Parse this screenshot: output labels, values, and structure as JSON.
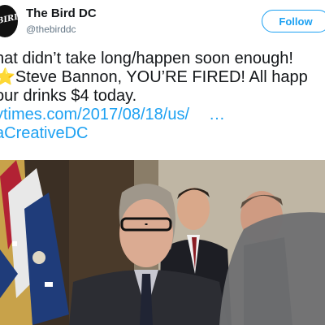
{
  "account": {
    "display_name": "The Bird DC",
    "handle": "@thebirddc",
    "avatar_text": "BIRD"
  },
  "follow_button": {
    "label": "Follow"
  },
  "tweet": {
    "line1": "hat didn’t take long/happen soon enough!",
    "line2_star": "⭐",
    "line2_text": "Steve Bannon, YOU’RE FIRED! All happ",
    "line3": "our drinks $4 today.",
    "url": "ytimes.com/2017/08/18/us/",
    "ellipsis": "…",
    "hashtag": "aCreativeDC"
  },
  "colors": {
    "link": "#1da1f2",
    "text": "#14171a",
    "secondary": "#657786",
    "star": "#f5b301"
  }
}
